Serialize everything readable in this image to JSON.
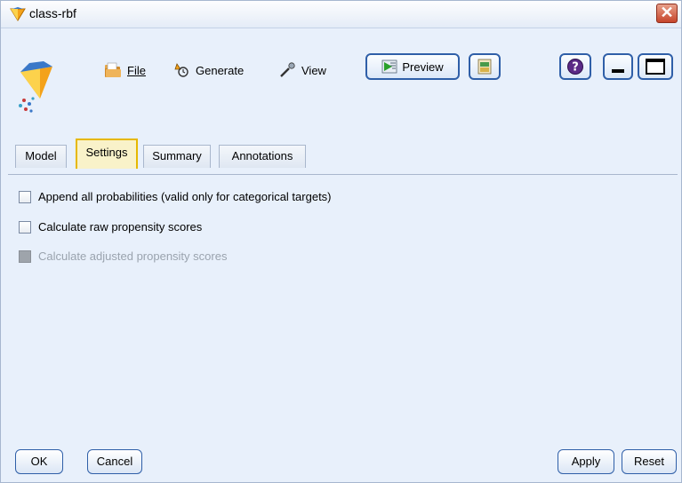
{
  "window": {
    "title": "class-rbf"
  },
  "toolbar": {
    "file_label": "File",
    "generate_label": "Generate",
    "view_label": "View",
    "preview_label": "Preview"
  },
  "icons": {
    "app": "model-nugget-icon",
    "file": "folder-icon",
    "generate": "generate-icon",
    "view": "view-icon",
    "preview": "preview-icon",
    "export": "export-icon",
    "help": "help-icon",
    "minimize": "minimize-icon",
    "maximize": "maximize-icon",
    "close": "close-icon"
  },
  "tabs": [
    {
      "label": "Model",
      "active": false
    },
    {
      "label": "Settings",
      "active": true
    },
    {
      "label": "Summary",
      "active": false
    },
    {
      "label": "Annotations",
      "active": false
    }
  ],
  "settings": {
    "options": [
      {
        "label": "Append all probabilities (valid only for categorical targets)",
        "checked": false,
        "enabled": true
      },
      {
        "label": "Calculate raw propensity scores",
        "checked": false,
        "enabled": true
      },
      {
        "label": "Calculate adjusted propensity scores",
        "checked": false,
        "enabled": false
      }
    ]
  },
  "footer": {
    "ok_label": "OK",
    "cancel_label": "Cancel",
    "apply_label": "Apply",
    "reset_label": "Reset"
  },
  "colors": {
    "background": "#e8f0fb",
    "active_tab": "#f9f2c9",
    "active_tab_border": "#e6b800",
    "button_border": "#2f5fa8"
  }
}
